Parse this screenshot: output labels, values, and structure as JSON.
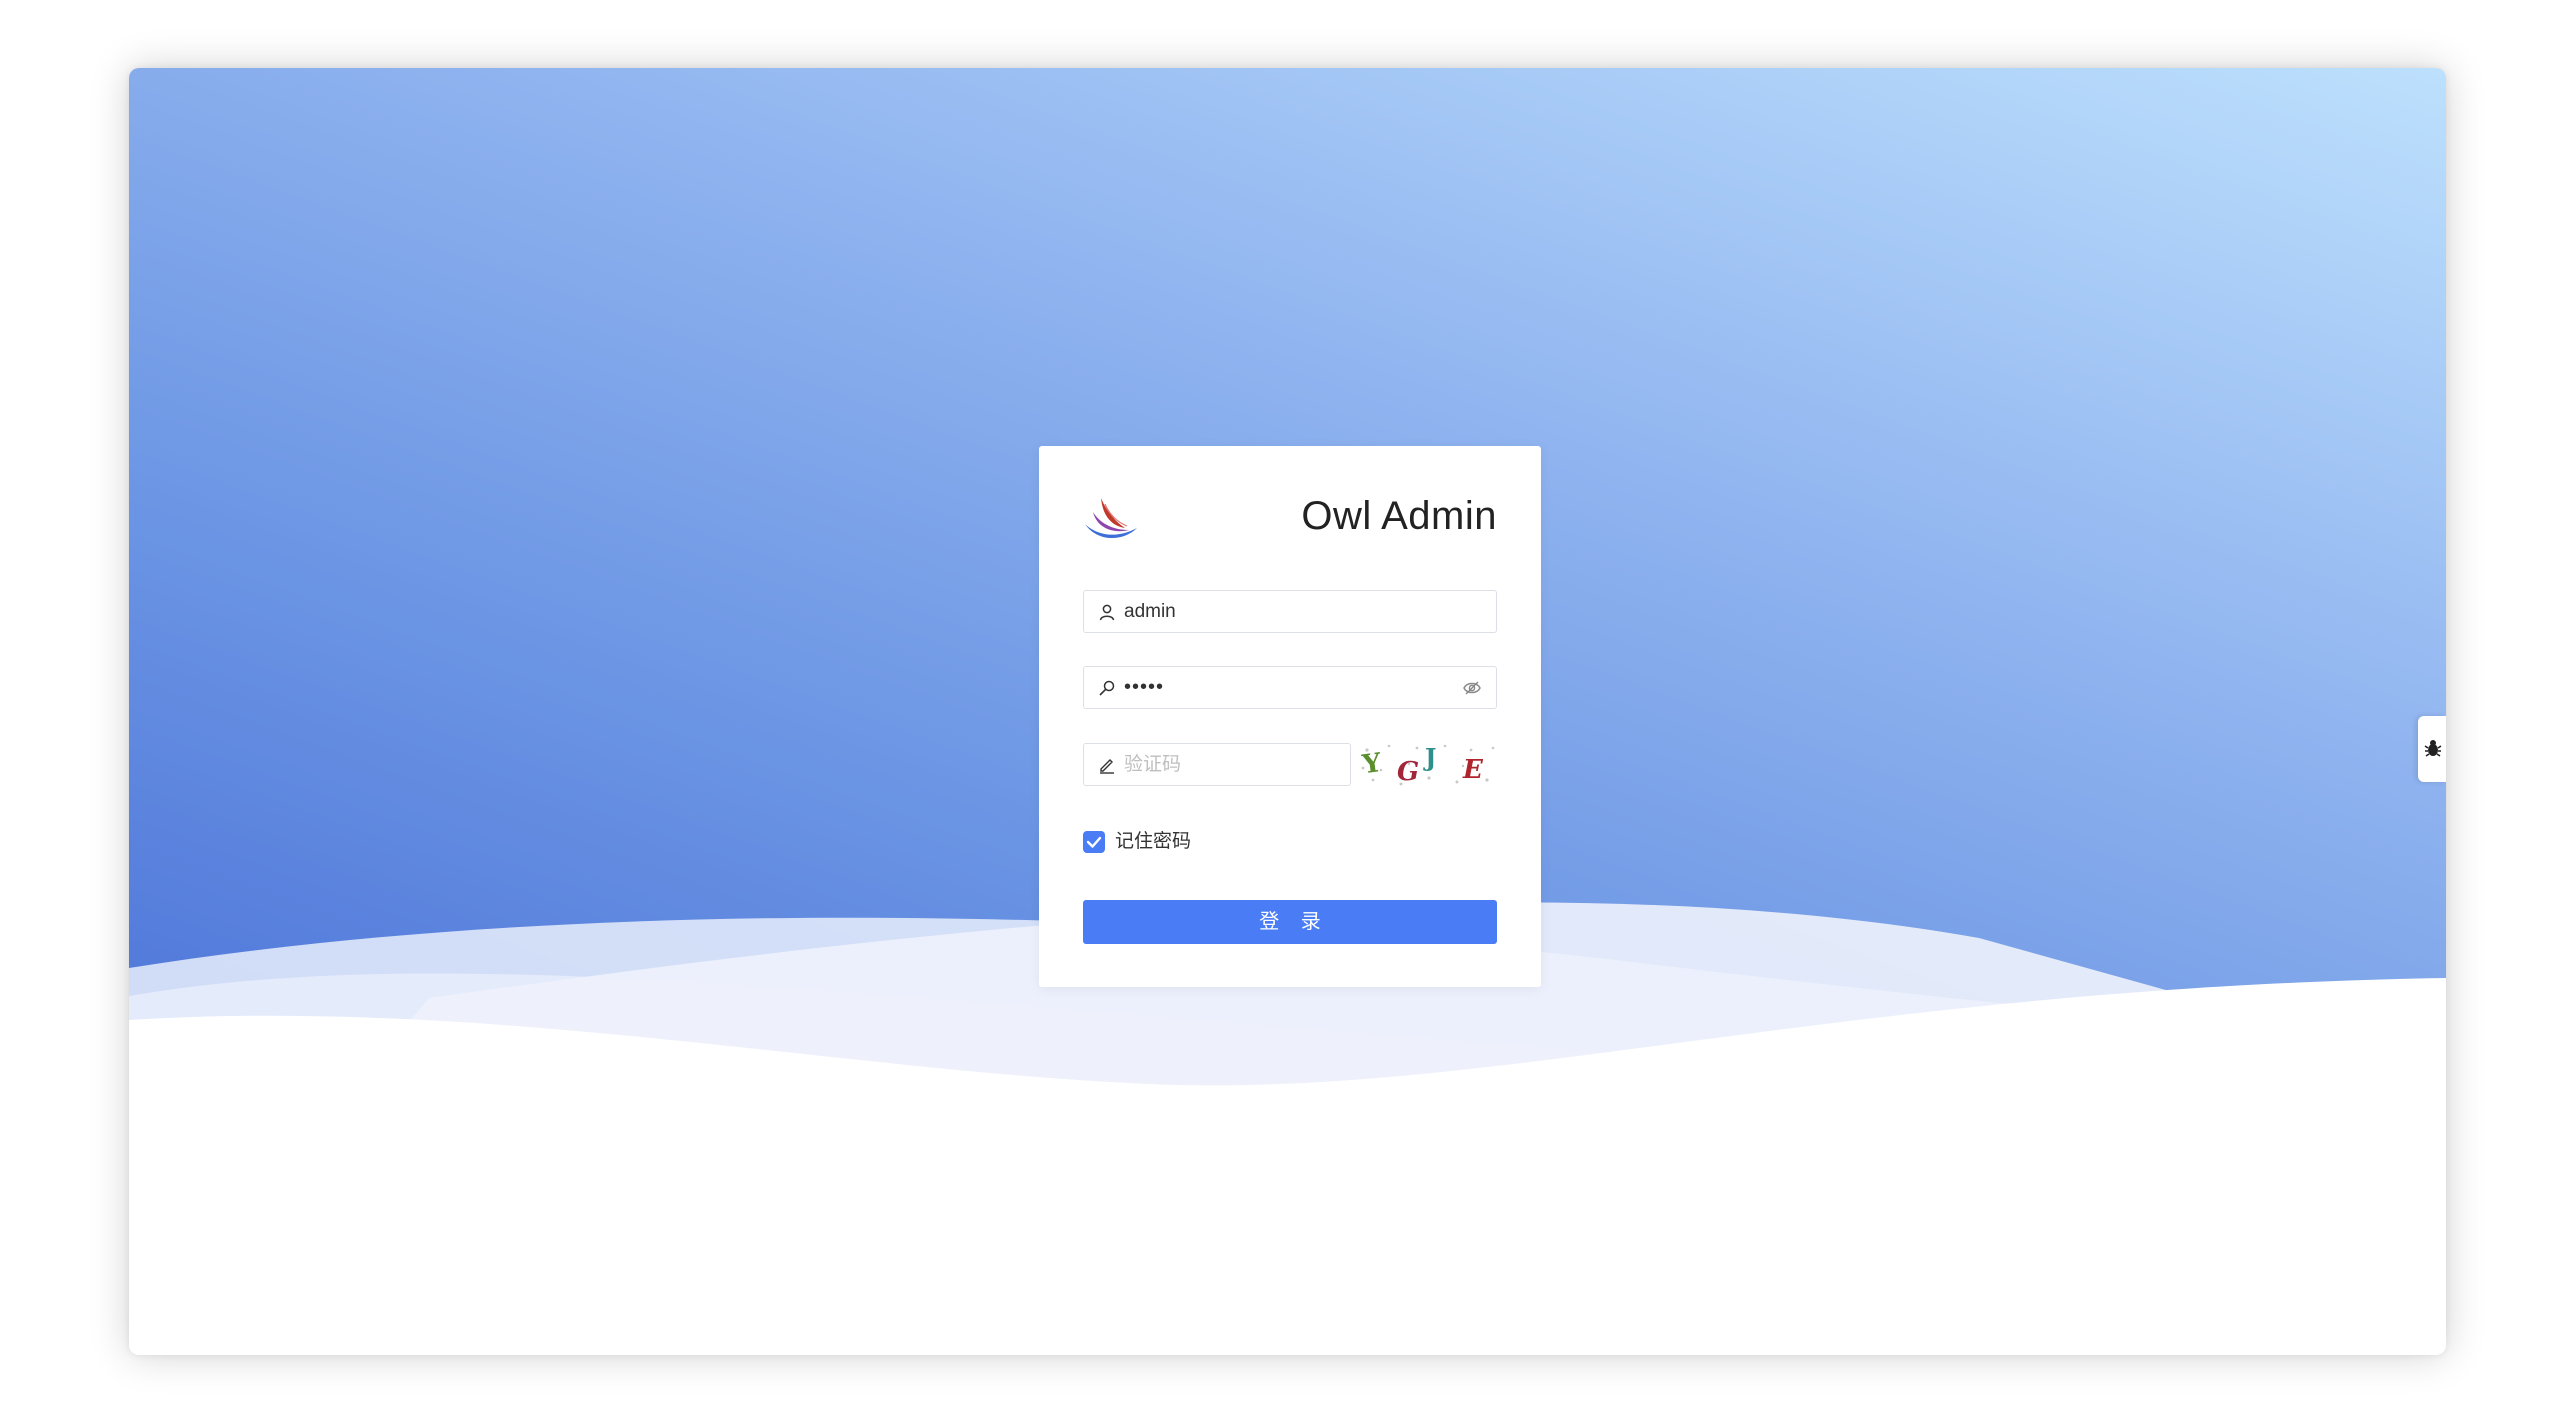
{
  "app": {
    "title": "Owl Admin"
  },
  "login_form": {
    "username": {
      "icon": "user-icon",
      "value": "admin"
    },
    "password": {
      "icon": "key-icon",
      "masked_value": "•••••",
      "toggle_icon": "eye-slash-icon"
    },
    "captcha": {
      "icon": "edit-icon",
      "placeholder": "验证码",
      "image_text": "YGJE"
    },
    "remember": {
      "label": "记住密码",
      "checked": true
    },
    "submit_label": "登 录"
  },
  "side_widget": {
    "icon": "bug-icon"
  },
  "colors": {
    "primary": "#4a7cf6",
    "sky_top": "#bde0fd",
    "sky_bottom": "#4c73d8"
  }
}
